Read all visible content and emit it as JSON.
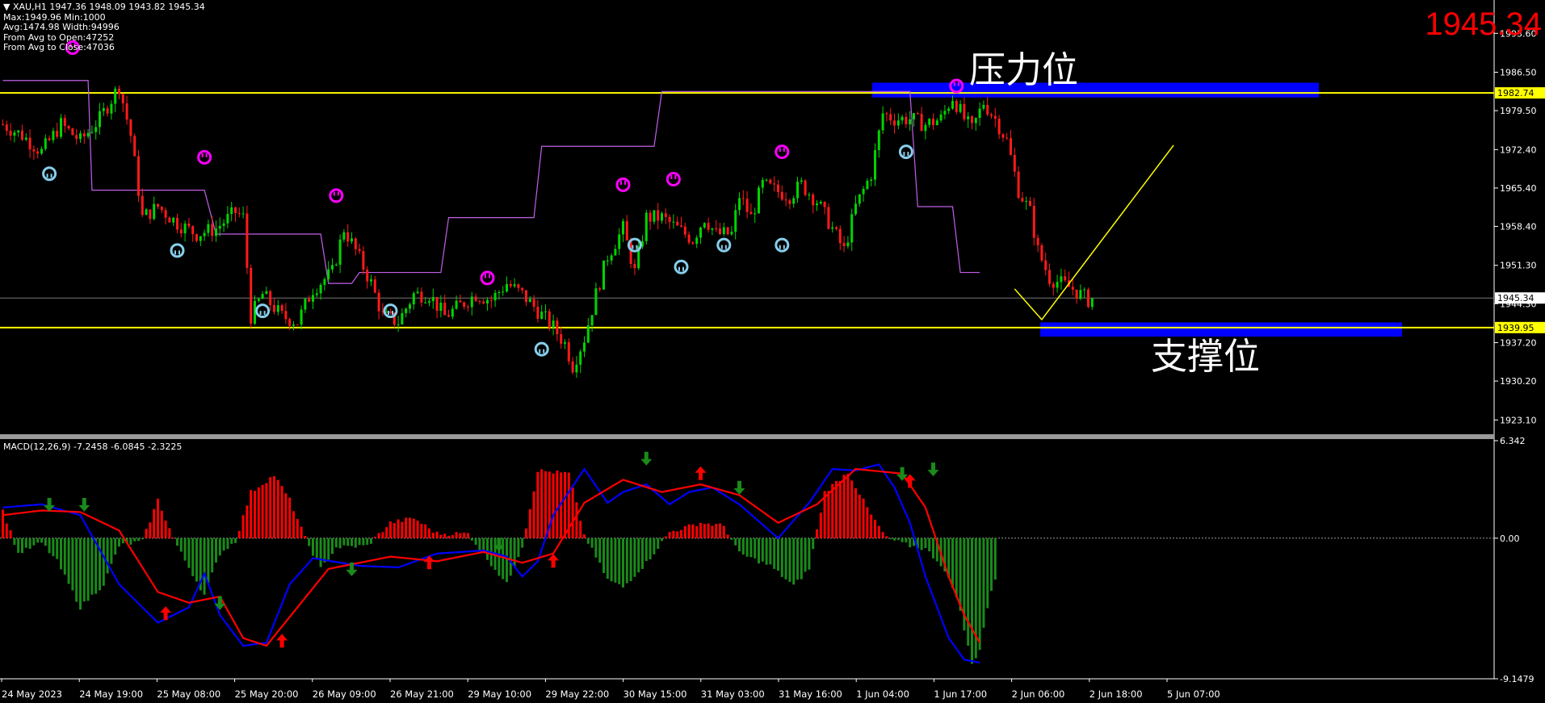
{
  "header": {
    "symbol_line": "▼ XAU,H1  1947.36 1948.09 1943.82 1945.34",
    "stats": [
      "Max:1949.96 Min:1000",
      "Avg:1474.98 Width:94996",
      "From Avg to Open:47252",
      "From Avg to Close:47036"
    ]
  },
  "big_price": "1945.34",
  "labels": {
    "resistance": "压力位",
    "support": "支撑位"
  },
  "macd": {
    "title": "MACD(12,26,9) -7.2458 -6.0845 -2.3225"
  },
  "colors": {
    "background": "#000000",
    "axis": "#ffffff",
    "bull": "#00d400",
    "bear": "#ff1a1a",
    "level": "#ffff00",
    "zone": "#0000ff",
    "step": "#c060e8",
    "macd_up": "#ff0000",
    "macd_down": "#1a8a1a",
    "macd_line": "#0000ff",
    "signal_line": "#ff0000",
    "peak_marker": "#ff00ff",
    "trough_marker": "#87ceeb"
  },
  "chart_data": [
    {
      "type": "candlestick",
      "title": "XAU,H1",
      "ylim": [
        1920.5,
        1998.5
      ],
      "y_ticks": [
        "1993.60",
        "1986.50",
        "1979.50",
        "1972.40",
        "1965.40",
        "1958.40",
        "1951.30",
        "1944.30",
        "1937.20",
        "1930.20",
        "1923.10"
      ],
      "x_ticks": [
        "24 May 2023",
        "24 May 19:00",
        "25 May 08:00",
        "25 May 20:00",
        "26 May 09:00",
        "26 May 21:00",
        "29 May 10:00",
        "29 May 22:00",
        "30 May 15:00",
        "31 May 03:00",
        "31 May 16:00",
        "1 Jun 04:00",
        "1 Jun 17:00",
        "2 Jun 06:00",
        "2 Jun 18:00",
        "5 Jun 07:00"
      ],
      "current_price": 1945.34,
      "current_price_label": "1945.34",
      "levels": [
        {
          "name": "resistance",
          "value": 1982.74,
          "label": "1982.74"
        },
        {
          "name": "support",
          "value": 1939.95,
          "label": "1939.95"
        }
      ],
      "resistance_zone": [
        1981.9,
        1984.6
      ],
      "support_zone": [
        1938.3,
        1940.9
      ],
      "anchors": [
        [
          0,
          1977
        ],
        [
          5,
          1975
        ],
        [
          10,
          1972
        ],
        [
          15,
          1977
        ],
        [
          20,
          1974
        ],
        [
          25,
          1978
        ],
        [
          30,
          1984
        ],
        [
          33,
          1975
        ],
        [
          36,
          1960
        ],
        [
          40,
          1962
        ],
        [
          45,
          1959
        ],
        [
          50,
          1957
        ],
        [
          55,
          1958
        ],
        [
          60,
          1961
        ],
        [
          62,
          1960
        ],
        [
          64,
          1942
        ],
        [
          67,
          1946
        ],
        [
          72,
          1942
        ],
        [
          76,
          1941
        ],
        [
          80,
          1947
        ],
        [
          85,
          1950
        ],
        [
          88,
          1958
        ],
        [
          91,
          1954
        ],
        [
          95,
          1948
        ],
        [
          98,
          1942
        ],
        [
          102,
          1941
        ],
        [
          106,
          1946
        ],
        [
          110,
          1946
        ],
        [
          114,
          1942
        ],
        [
          118,
          1944
        ],
        [
          122,
          1946
        ],
        [
          126,
          1945
        ],
        [
          130,
          1948
        ],
        [
          134,
          1946
        ],
        [
          138,
          1943
        ],
        [
          142,
          1940
        ],
        [
          145,
          1937
        ],
        [
          147,
          1933
        ],
        [
          150,
          1938
        ],
        [
          153,
          1946
        ],
        [
          156,
          1953
        ],
        [
          160,
          1958
        ],
        [
          163,
          1950
        ],
        [
          166,
          1960
        ],
        [
          170,
          1960
        ],
        [
          174,
          1958
        ],
        [
          178,
          1956
        ],
        [
          181,
          1960
        ],
        [
          184,
          1957
        ],
        [
          188,
          1957
        ],
        [
          190,
          1964
        ],
        [
          193,
          1960
        ],
        [
          196,
          1966
        ],
        [
          199,
          1965
        ],
        [
          203,
          1964
        ],
        [
          206,
          1966
        ],
        [
          210,
          1963
        ],
        [
          214,
          1958
        ],
        [
          217,
          1954
        ],
        [
          220,
          1962
        ],
        [
          224,
          1968
        ],
        [
          227,
          1979
        ],
        [
          230,
          1978
        ],
        [
          234,
          1978
        ],
        [
          238,
          1977
        ],
        [
          242,
          1978
        ],
        [
          245,
          1982
        ],
        [
          248,
          1978
        ],
        [
          250,
          1976
        ],
        [
          253,
          1981
        ],
        [
          256,
          1978
        ],
        [
          259,
          1974
        ],
        [
          262,
          1965
        ],
        [
          265,
          1961
        ],
        [
          267,
          1954
        ],
        [
          270,
          1949
        ],
        [
          273,
          1948
        ],
        [
          276,
          1947
        ],
        [
          278,
          1946
        ],
        [
          280,
          1945
        ]
      ],
      "step_line": [
        [
          0,
          1985
        ],
        [
          22,
          1985
        ],
        [
          23,
          1965
        ],
        [
          52,
          1965
        ],
        [
          55,
          1957
        ],
        [
          82,
          1957
        ],
        [
          84,
          1948
        ],
        [
          90,
          1948
        ],
        [
          92,
          1950
        ],
        [
          113,
          1950
        ],
        [
          115,
          1960
        ],
        [
          137,
          1960
        ],
        [
          139,
          1973
        ],
        [
          168,
          1973
        ],
        [
          170,
          1983
        ],
        [
          226,
          1983
        ],
        [
          228,
          1983
        ],
        [
          234,
          1983
        ],
        [
          236,
          1962
        ],
        [
          245,
          1962
        ],
        [
          247,
          1950
        ],
        [
          252,
          1950
        ]
      ],
      "peak_markers": [
        [
          18,
          1991
        ],
        [
          52,
          1971
        ],
        [
          86,
          1964
        ],
        [
          125,
          1949
        ],
        [
          160,
          1966
        ],
        [
          173,
          1967
        ],
        [
          201,
          1972
        ],
        [
          246,
          1984
        ]
      ],
      "trough_markers": [
        [
          12,
          1968
        ],
        [
          45,
          1954
        ],
        [
          67,
          1943
        ],
        [
          100,
          1943
        ],
        [
          139,
          1936
        ],
        [
          163,
          1955
        ],
        [
          175,
          1951
        ],
        [
          186,
          1955
        ],
        [
          201,
          1955
        ],
        [
          233,
          1972
        ]
      ],
      "projection": [
        [
          261,
          1947
        ],
        [
          268,
          1941.4
        ],
        [
          302,
          1973.2
        ]
      ]
    },
    {
      "type": "macd",
      "title": "MACD(12,26,9)",
      "ylim": [
        -9.1479,
        6.342
      ],
      "y_ticks": [
        "6.342",
        "0.00",
        "-9.1479"
      ],
      "values": {
        "macd": -7.2458,
        "signal": -6.0845,
        "histogram": -2.3225
      },
      "macd_anchors": [
        [
          0,
          2.0
        ],
        [
          10,
          2.2
        ],
        [
          20,
          1.5
        ],
        [
          30,
          -3
        ],
        [
          40,
          -5.5
        ],
        [
          48,
          -4.5
        ],
        [
          52,
          -2.3
        ],
        [
          56,
          -5
        ],
        [
          62,
          -7
        ],
        [
          68,
          -6.8
        ],
        [
          74,
          -3
        ],
        [
          80,
          -1.3
        ],
        [
          92,
          -1.8
        ],
        [
          102,
          -1.9
        ],
        [
          112,
          -1.0
        ],
        [
          124,
          -0.8
        ],
        [
          130,
          -1.2
        ],
        [
          134,
          -2.5
        ],
        [
          138,
          -1.5
        ],
        [
          142,
          1.5
        ],
        [
          150,
          4.5
        ],
        [
          156,
          2.3
        ],
        [
          160,
          3.0
        ],
        [
          166,
          3.5
        ],
        [
          172,
          2.2
        ],
        [
          177,
          3.0
        ],
        [
          183,
          3.3
        ],
        [
          190,
          2.2
        ],
        [
          200,
          0
        ],
        [
          208,
          2.3
        ],
        [
          214,
          4.5
        ],
        [
          220,
          4.4
        ],
        [
          226,
          4.8
        ],
        [
          230,
          3.3
        ],
        [
          234,
          1.0
        ],
        [
          238,
          -2.5
        ],
        [
          244,
          -6.5
        ],
        [
          248,
          -7.9
        ],
        [
          252,
          -8.1
        ]
      ],
      "signal_anchors": [
        [
          0,
          1.5
        ],
        [
          10,
          1.8
        ],
        [
          20,
          1.7
        ],
        [
          30,
          0.5
        ],
        [
          40,
          -3.5
        ],
        [
          48,
          -4.2
        ],
        [
          56,
          -3.8
        ],
        [
          62,
          -6.5
        ],
        [
          68,
          -7.0
        ],
        [
          76,
          -4.5
        ],
        [
          84,
          -2.0
        ],
        [
          100,
          -1.2
        ],
        [
          112,
          -1.5
        ],
        [
          124,
          -0.9
        ],
        [
          134,
          -1.6
        ],
        [
          142,
          -1.0
        ],
        [
          150,
          2.3
        ],
        [
          160,
          3.8
        ],
        [
          170,
          3.0
        ],
        [
          180,
          3.5
        ],
        [
          190,
          2.8
        ],
        [
          200,
          1.0
        ],
        [
          210,
          2.2
        ],
        [
          220,
          4.5
        ],
        [
          232,
          4.2
        ],
        [
          238,
          2.0
        ],
        [
          244,
          -2.5
        ],
        [
          248,
          -5.0
        ],
        [
          252,
          -6.8
        ]
      ],
      "hist_anchors": [
        [
          0,
          1.8
        ],
        [
          4,
          -1
        ],
        [
          10,
          -0.3
        ],
        [
          14,
          -1.5
        ],
        [
          20,
          -4.5
        ],
        [
          26,
          -3
        ],
        [
          30,
          -0.5
        ],
        [
          36,
          -0.2
        ],
        [
          40,
          2.5
        ],
        [
          44,
          0
        ],
        [
          46,
          -1
        ],
        [
          52,
          -3.7
        ],
        [
          56,
          -1
        ],
        [
          60,
          -0.2
        ],
        [
          64,
          3
        ],
        [
          70,
          4.1
        ],
        [
          74,
          2.5
        ],
        [
          78,
          0
        ],
        [
          82,
          -2
        ],
        [
          86,
          -0.6
        ],
        [
          94,
          -0.5
        ],
        [
          100,
          1
        ],
        [
          106,
          1.3
        ],
        [
          112,
          0.3
        ],
        [
          120,
          0.3
        ],
        [
          130,
          -3
        ],
        [
          134,
          -0.5
        ],
        [
          138,
          4.4
        ],
        [
          146,
          4.2
        ],
        [
          150,
          0.2
        ],
        [
          156,
          -2.7
        ],
        [
          160,
          -3.2
        ],
        [
          166,
          -1.6
        ],
        [
          172,
          0.4
        ],
        [
          180,
          1
        ],
        [
          186,
          0.8
        ],
        [
          190,
          -1
        ],
        [
          198,
          -1.8
        ],
        [
          204,
          -3.1
        ],
        [
          208,
          -2.0
        ],
        [
          212,
          3
        ],
        [
          218,
          4.3
        ],
        [
          224,
          1.5
        ],
        [
          228,
          0
        ],
        [
          234,
          -0.5
        ],
        [
          238,
          -0.7
        ],
        [
          242,
          -1.7
        ],
        [
          246,
          -3.7
        ],
        [
          250,
          -8.2
        ],
        [
          252,
          -7.2
        ],
        [
          254,
          -4.5
        ],
        [
          256,
          -2.6
        ]
      ],
      "up_arrows": [
        [
          42,
          -4.9
        ],
        [
          72,
          -6.7
        ],
        [
          110,
          -1.6
        ],
        [
          142,
          -1.5
        ],
        [
          180,
          4.2
        ],
        [
          234,
          3.7
        ]
      ],
      "down_arrows": [
        [
          12,
          2.2
        ],
        [
          21,
          2.2
        ],
        [
          56,
          -4.2
        ],
        [
          90,
          -2.0
        ],
        [
          128,
          -0.4
        ],
        [
          166,
          5.2
        ],
        [
          190,
          3.3
        ],
        [
          232,
          4.2
        ],
        [
          240,
          4.5
        ]
      ]
    }
  ]
}
